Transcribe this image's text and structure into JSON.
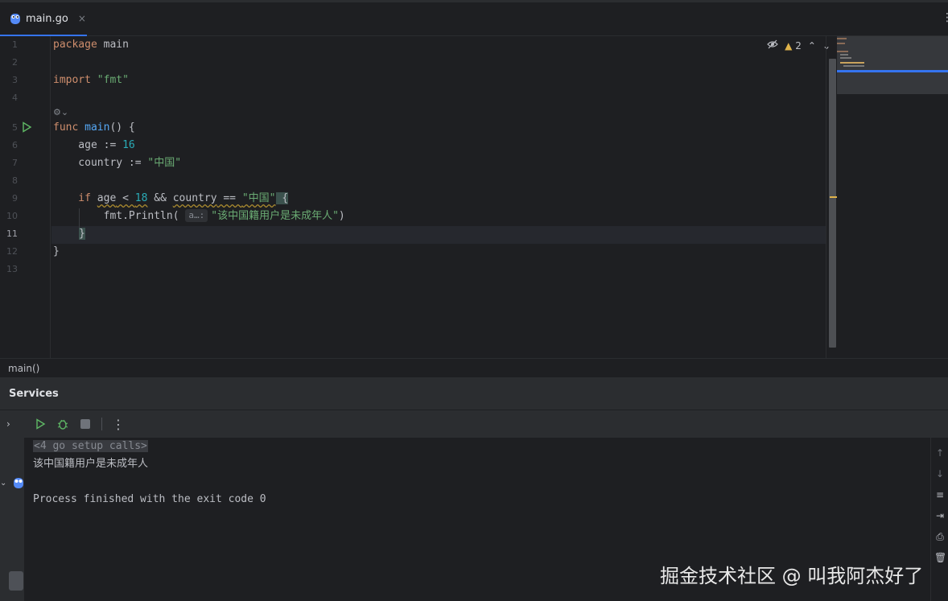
{
  "tab": {
    "label": "main.go",
    "close": "×"
  },
  "editor": {
    "line_numbers": [
      "1",
      "2",
      "3",
      "4",
      "5",
      "6",
      "7",
      "8",
      "9",
      "10",
      "11",
      "12",
      "13"
    ],
    "current_line": "11",
    "warning_count": "2",
    "lines": {
      "l1_kw": "package",
      "l1_id": " main",
      "l3_kw": "import",
      "l3_str": " \"fmt\"",
      "l5_kw": "func",
      "l5_fn": " main",
      "l5_rest": "() {",
      "l6_a": "    age := ",
      "l6_num": "16",
      "l7_a": "    country := ",
      "l7_str": "\"中国\"",
      "l9_kw": "    if ",
      "l9_age": "age",
      "l9_op1": " < ",
      "l9_num": "18",
      "l9_op2": " && ",
      "l9_country": "country",
      "l9_op3": " == ",
      "l9_str": "\"中国\"",
      "l9_brace": " {",
      "l10_a": "        fmt.",
      "l10_fn": "Println",
      "l10_paren": "(",
      "l10_hint": "a…:",
      "l10_str": "\"该中国籍用户是未成年人\"",
      "l10_close": ")",
      "l11_brace": "}",
      "l12_brace": "}"
    }
  },
  "breadcrumb": {
    "label": "main()"
  },
  "services": {
    "title": "Services",
    "console": {
      "setup_calls": "<4 go setup calls>",
      "output": "该中国籍用户是未成年人",
      "finished": "Process finished with the exit code 0"
    }
  },
  "watermark": "掘金技术社区 @ 叫我阿杰好了",
  "colors": {
    "accent": "#3574f0",
    "keyword": "#cf8e6d",
    "string": "#6aab73",
    "number": "#2aacb8",
    "function": "#56a8f5",
    "warning": "#e0b34a"
  }
}
